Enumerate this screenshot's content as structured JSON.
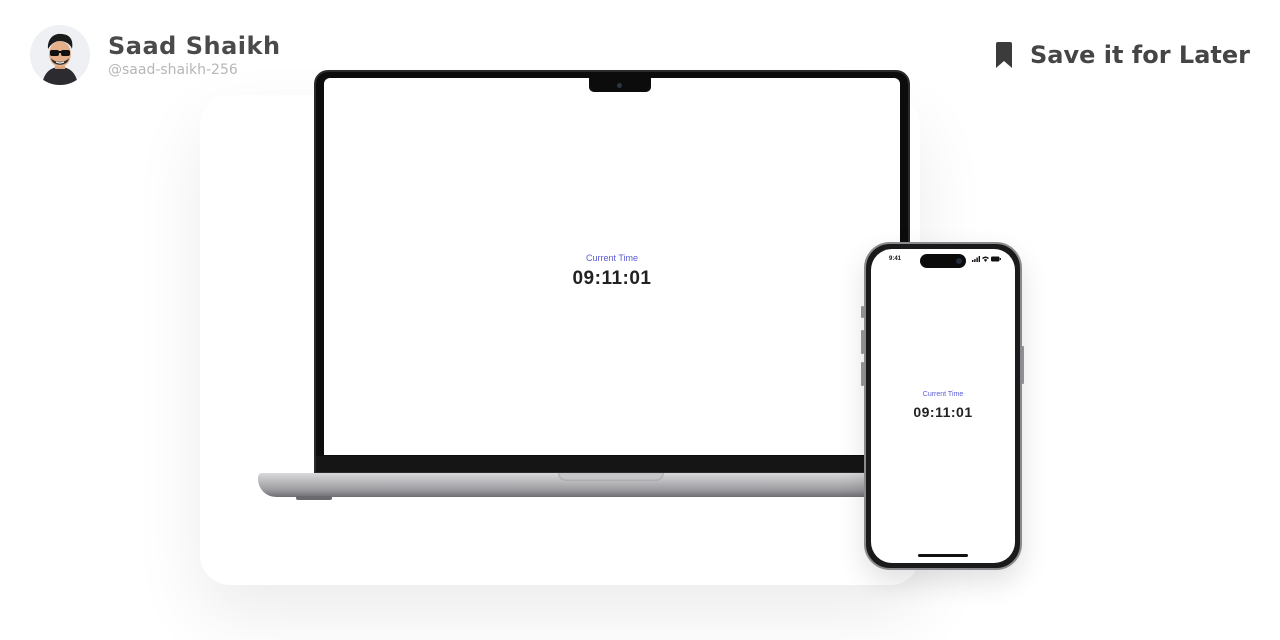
{
  "author": {
    "name": "Saad Shaikh",
    "handle": "@saad-shaikh-256"
  },
  "save": {
    "label": "Save it for Later",
    "icon": "bookmark-icon"
  },
  "laptop": {
    "time_label": "Current Time",
    "time_value": "09:11:01"
  },
  "phone": {
    "status_time": "9:41",
    "time_label": "Current Time",
    "time_value": "09:11:01"
  },
  "colors": {
    "accent": "#5b5bd6",
    "heading": "#4a4a4a",
    "muted": "#b6b6b6"
  }
}
